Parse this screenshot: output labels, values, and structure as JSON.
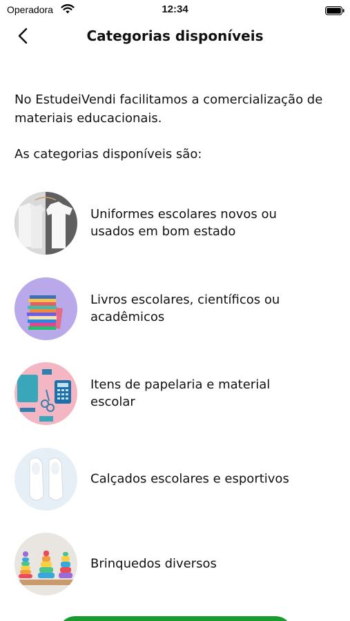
{
  "status_bar": {
    "carrier": "Operadora",
    "time": "12:34",
    "wifi_icon": "wifi-icon",
    "battery_icon": "battery-icon"
  },
  "nav": {
    "back_icon": "chevron-left-icon",
    "title": "Categorias disponíveis"
  },
  "intro": "No EstudeiVendi facilitamos a comercialização de materiais educacionais.",
  "subtitle": "As categorias disponíveis são:",
  "categories": [
    {
      "label": "Uniformes escolares novos ou usados em bom estado",
      "image": "school-uniform-shirts"
    },
    {
      "label": "Livros escolares, científicos ou acadêmicos",
      "image": "book-stack"
    },
    {
      "label": "Itens de papelaria e material escolar",
      "image": "stationery-items"
    },
    {
      "label": "Calçados escolares e esportivos",
      "image": "white-sneakers"
    },
    {
      "label": "Brinquedos diversos",
      "image": "stacking-toys"
    }
  ],
  "colors": {
    "primary_button": "#1a9b2e",
    "text": "#111111",
    "background": "#ffffff"
  }
}
